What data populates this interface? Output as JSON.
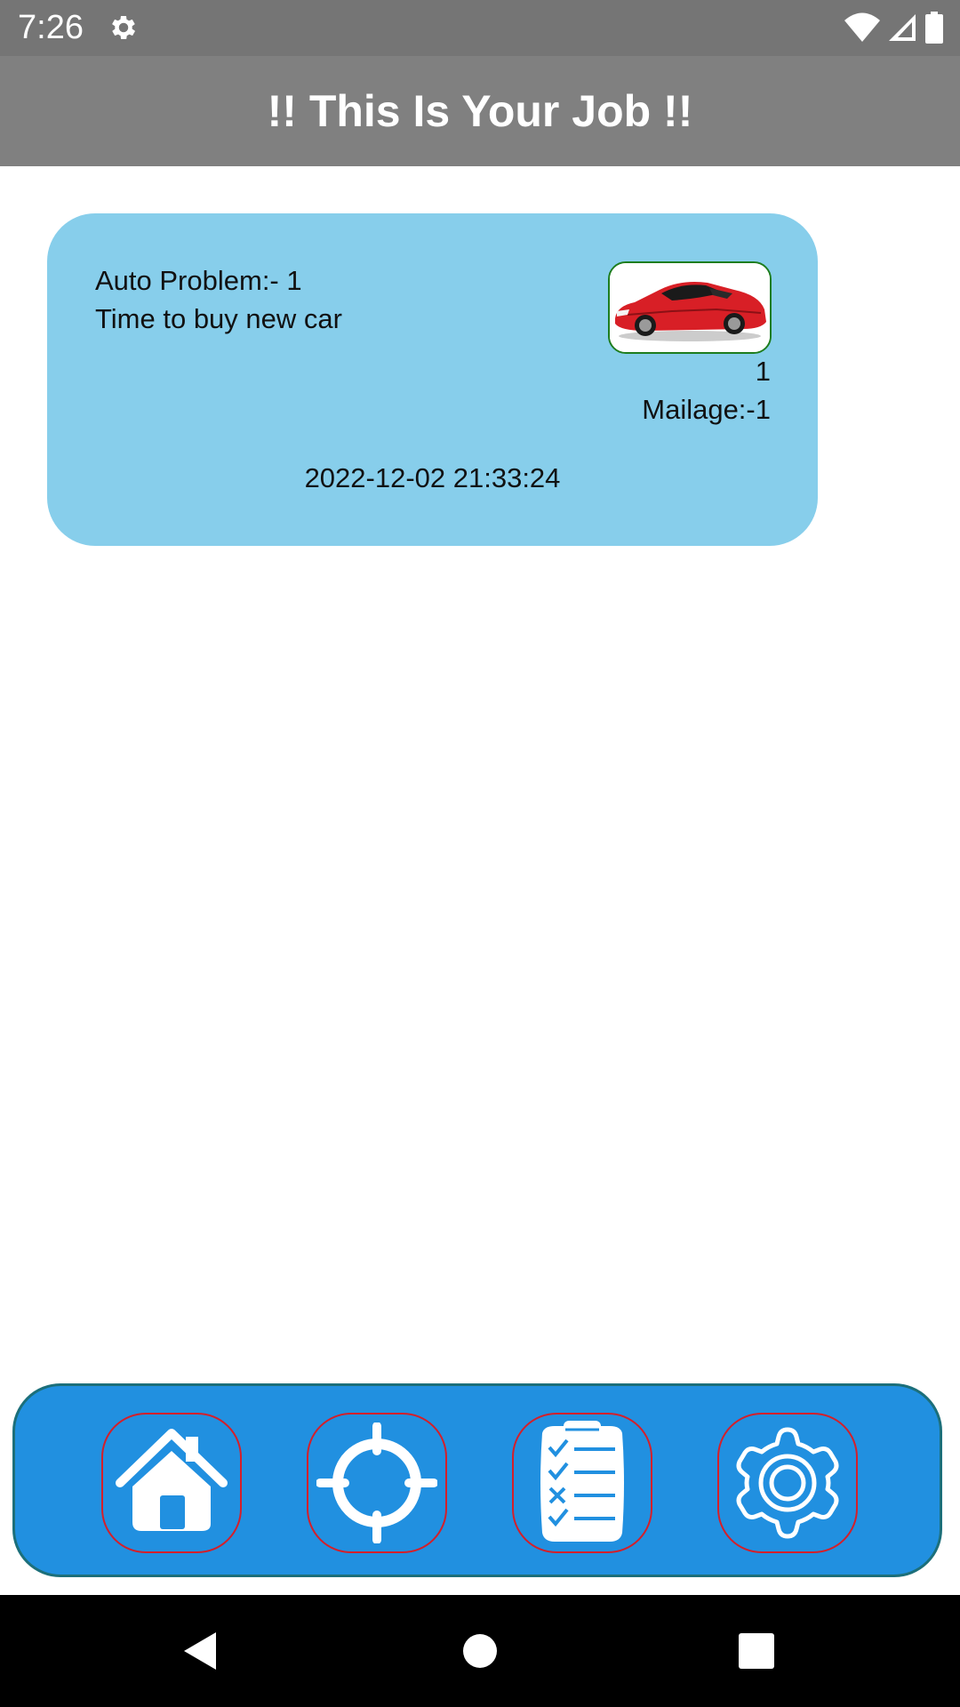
{
  "status_bar": {
    "time": "7:26",
    "icons": [
      "gear-icon",
      "wifi-icon",
      "signal-icon",
      "battery-icon"
    ]
  },
  "header": {
    "title": "!! This Is Your Job !!"
  },
  "job_card": {
    "problem_title": "Auto Problem:- 1",
    "problem_description": "Time to buy new car",
    "number": "1",
    "mileage": "Mailage:-1",
    "date": "2022-12-02 21:33:24",
    "image": "red-sports-car-image"
  },
  "bottom_nav": {
    "items": [
      {
        "icon": "home-icon"
      },
      {
        "icon": "crosshair-icon"
      },
      {
        "icon": "checklist-icon"
      },
      {
        "icon": "settings-gear-icon"
      }
    ]
  },
  "system_nav": {
    "buttons": [
      "back-icon",
      "home-circle-icon",
      "recents-square-icon"
    ]
  },
  "colors": {
    "status_bar": "#757575",
    "title_bar": "#808080",
    "card_background": "#87ceeb",
    "nav_background": "#2190e0",
    "nav_border": "#1c6f7a",
    "nav_button_border": "#d41f2a",
    "image_border": "#1e7d1e"
  }
}
